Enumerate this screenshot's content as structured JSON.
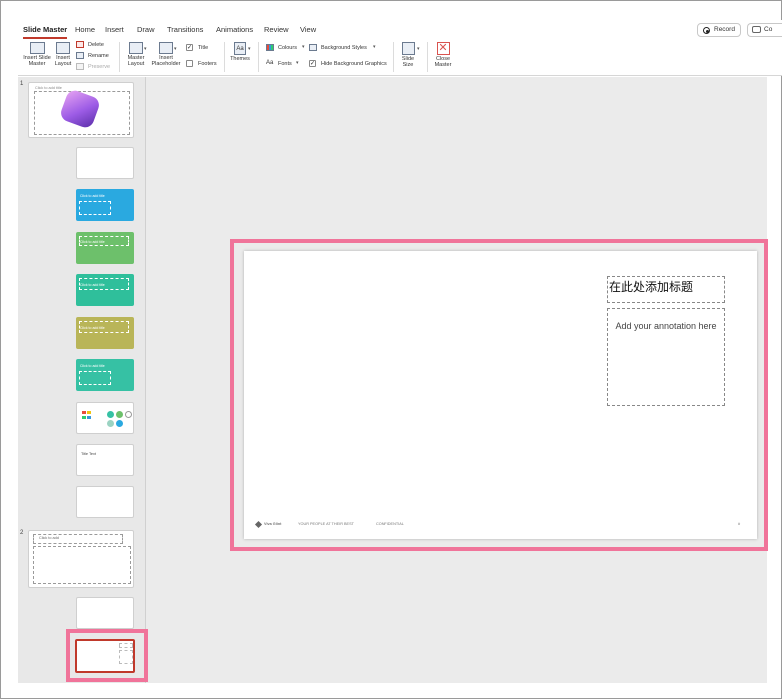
{
  "ribbon": {
    "tabs": [
      "Slide Master",
      "Home",
      "Insert",
      "Draw",
      "Transitions",
      "Animations",
      "Review",
      "View"
    ],
    "record_label": "Record",
    "comments_label": "Co",
    "insert_slide_master": "Insert Slide Master",
    "insert_layout": "Insert Layout",
    "delete": "Delete",
    "rename": "Rename",
    "preserve": "Preserve",
    "master_layout": "Master Layout",
    "insert_placeholder": "Insert Placeholder",
    "title_check": "Title",
    "footers_check": "Footers",
    "themes": "Themes",
    "colours": "Colours",
    "fonts": "Fonts",
    "background_styles": "Background Styles",
    "hide_background_graphics": "Hide Background Graphics",
    "slide_size": "Slide Size",
    "close_master": "Close Master"
  },
  "thumbnails": {
    "master1_number": "1",
    "master2_number": "2",
    "master1_title": "Click to add title",
    "layout_title": "Click to add title",
    "title_text_thumb": "Title Text",
    "master2_title": "Click to add",
    "colors": {
      "blue": "#2aa9e0",
      "green": "#6dc06b",
      "teal": "#2fbf9b",
      "olive": "#b9b558",
      "teal2": "#36c1a4",
      "selection": "#f0749a",
      "accent_tab": "#c0392b"
    }
  },
  "slide": {
    "title_placeholder": "在此处添加标题",
    "annotation_placeholder": "Add your annotation here",
    "footer_brand": "Viva Glint",
    "footer_text": "YOUR PEOPLE AT THEIR BEST",
    "footer_confidential": "CONFIDENTIAL",
    "footer_page": "#"
  }
}
